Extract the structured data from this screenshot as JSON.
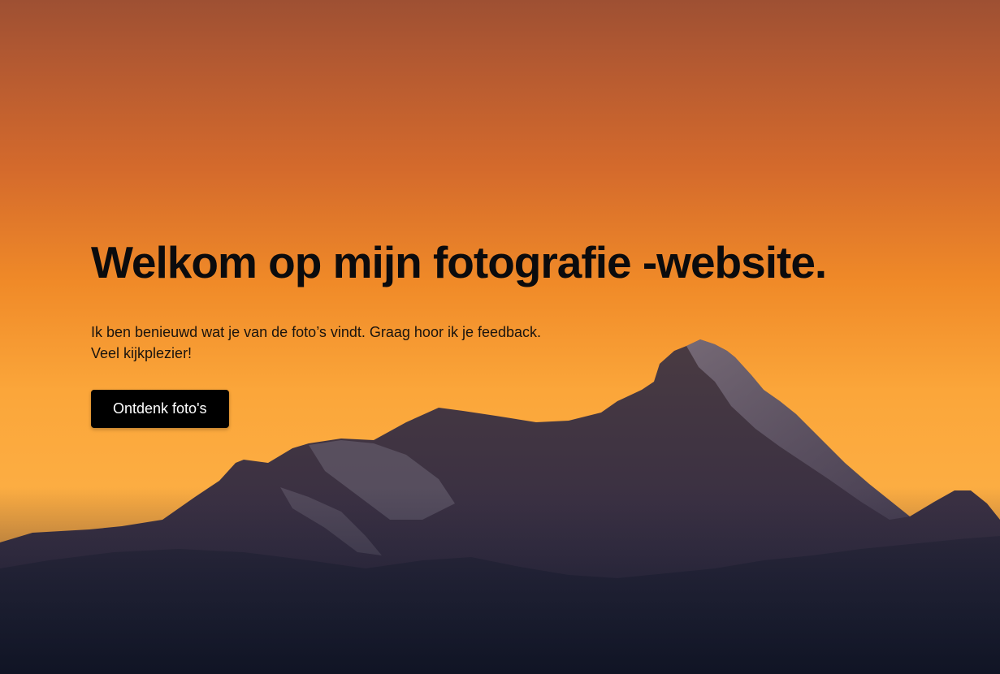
{
  "hero": {
    "title": "Welkom op mijn fotografie -website.",
    "text_line1": "Ik ben benieuwd wat je van de foto’s vindt. Graag hoor ik je feedback.",
    "text_line2": "Veel kijkplezier!",
    "button_label": "Ontdenk foto's",
    "background_image": "mountain-sunset-photo"
  },
  "colors": {
    "sky_top": "#a85534",
    "sky_mid": "#f08b2a",
    "sky_low": "#fcae3f",
    "mountain_far": "#3a3040",
    "mountain_near": "#161a2a",
    "button_bg": "#000000",
    "button_text": "#ffffff",
    "title_text": "#0b0b0d"
  }
}
